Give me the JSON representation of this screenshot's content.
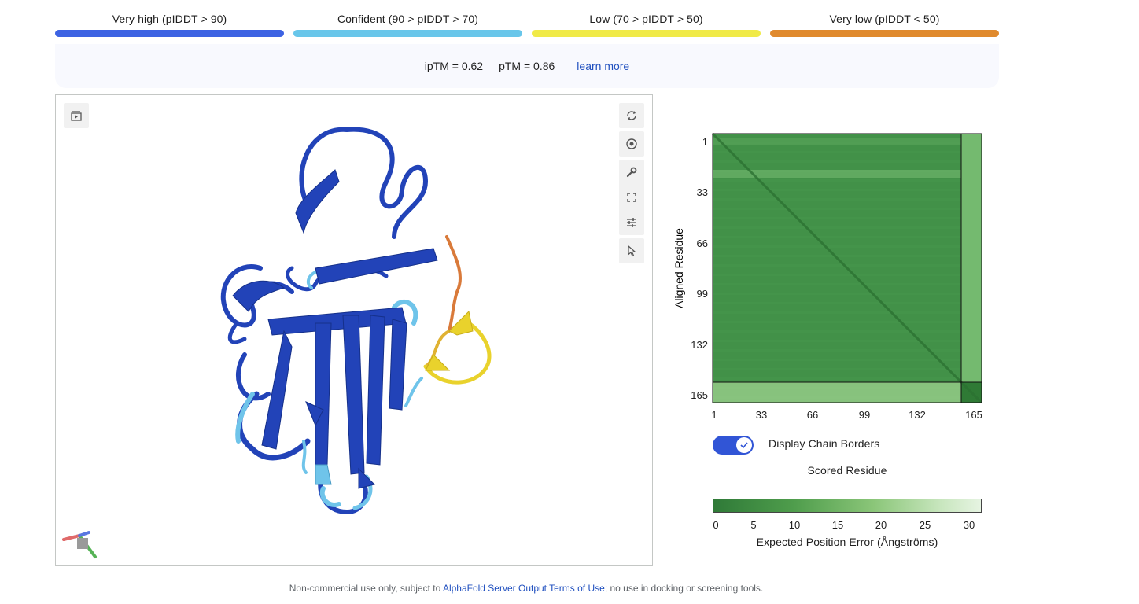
{
  "legend": [
    {
      "label": "Very high (pIDDT > 90)",
      "color": "#3d63e3"
    },
    {
      "label": "Confident (90 > pIDDT > 70)",
      "color": "#68c6ea"
    },
    {
      "label": "Low (70 > pIDDT > 50)",
      "color": "#f0ea47"
    },
    {
      "label": "Very low (pIDDT < 50)",
      "color": "#e08a2e"
    }
  ],
  "metrics": {
    "iptm": "ipTM = 0.62",
    "ptm": "pTM = 0.86",
    "learn_more": "learn more"
  },
  "viewer": {
    "tools": [
      "layers-icon",
      "rotate-icon",
      "camera-aperture-icon",
      "wrench-icon",
      "fullscreen-icon",
      "sliders-icon",
      "cursor-icon"
    ]
  },
  "pae": {
    "y_axis_title": "Aligned Residue",
    "x_axis_title": "Scored Residue",
    "y_ticks": [
      "1",
      "33",
      "66",
      "99",
      "132",
      "165"
    ],
    "x_ticks": [
      "1",
      "33",
      "66",
      "99",
      "132",
      "165"
    ],
    "chain_borders_label": "Display Chain Borders",
    "chain_borders_on": true,
    "colorbar_ticks": [
      "0",
      "5",
      "10",
      "15",
      "20",
      "25",
      "30"
    ],
    "colorbar_title": "Expected Position Error (Ångströms)"
  },
  "footer": {
    "prefix": "Non-commercial use only, subject to ",
    "link": "AlphaFold Server Output Terms of Use",
    "suffix": "; no use in docking or screening tools."
  }
}
